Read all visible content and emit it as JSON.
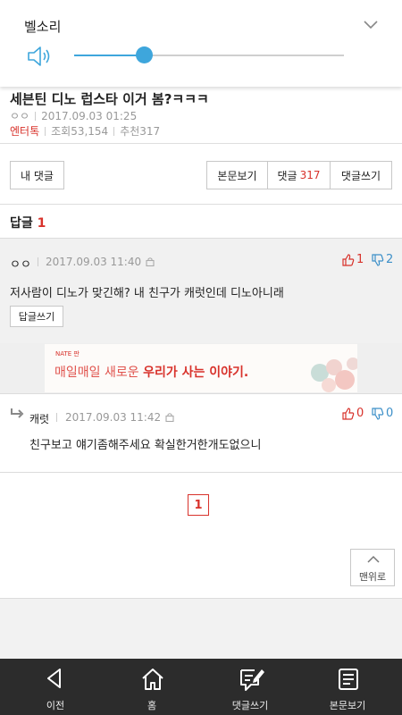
{
  "bell": {
    "title": "벨소리",
    "volume_level": 0.26
  },
  "article": {
    "title": "세븐틴 디노 럽스타 이거 봄?ㅋㅋㅋ",
    "author": "ㅇㅇ",
    "datetime": "2017.09.03 01:25",
    "category": "엔터톡",
    "views": "조회53,154",
    "recommends": "추천317"
  },
  "actions": {
    "my_comments": "내 댓글",
    "view_post": "본문보기",
    "comments_label": "댓글",
    "comments_count": "317",
    "write_comment": "댓글쓰기"
  },
  "replies": {
    "label": "답글",
    "count": "1"
  },
  "comment": {
    "author": "ㅇㅇ",
    "datetime": "2017.09.03 11:40",
    "up": "1",
    "down": "2",
    "text": "저사람이 디노가 맞긴해? 내 친구가 캐럿인데 디노아니래",
    "reply_button": "답글쓰기"
  },
  "banner": {
    "brand": "NATE 판",
    "text_prefix": "매일매일 새로운 ",
    "text_bold": "우리가 사는 이야기."
  },
  "reply": {
    "author": "캐럿",
    "datetime": "2017.09.03 11:42",
    "up": "0",
    "down": "0",
    "text": "친구보고 얘기좀해주세요 확실한거한개도없으니"
  },
  "pagination": {
    "current": "1"
  },
  "scroll_top": {
    "label": "맨위로"
  },
  "nav": {
    "items": [
      {
        "label": "이전",
        "icon": "back-arrow-icon"
      },
      {
        "label": "홈",
        "icon": "home-icon"
      },
      {
        "label": "댓글쓰기",
        "icon": "comment-write-icon"
      },
      {
        "label": "본문보기",
        "icon": "document-icon"
      }
    ]
  },
  "colors": {
    "accent_red": "#d8322b",
    "accent_blue": "#3ea6dc",
    "nav_bg": "#2c2c2c"
  }
}
